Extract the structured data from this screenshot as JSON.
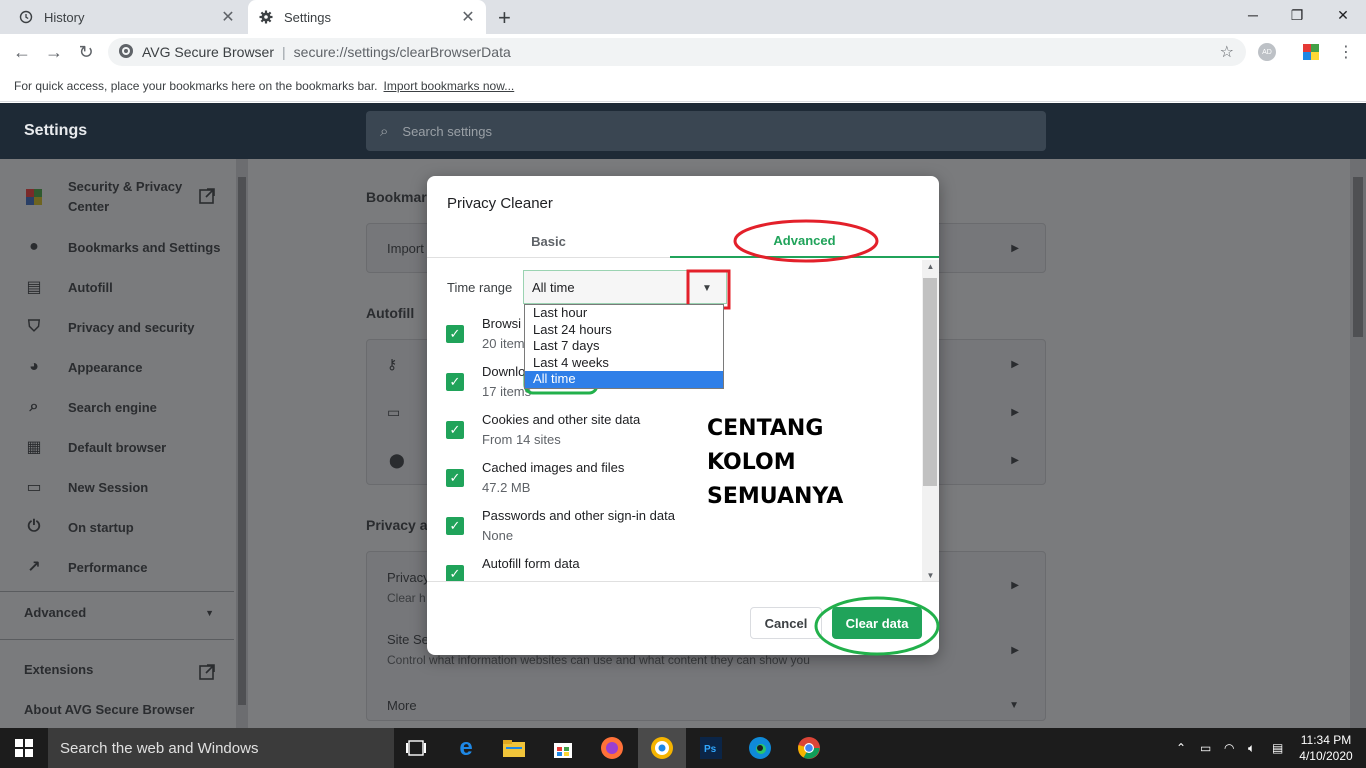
{
  "browser": {
    "tabs": [
      {
        "label": "History",
        "icon": "history-icon"
      },
      {
        "label": "Settings",
        "icon": "gear-icon"
      }
    ],
    "omnibox": {
      "site_name": "AVG Secure Browser",
      "url": "secure://settings/clearBrowserData"
    },
    "avatar_initials": "AD",
    "bookmarks_bar": {
      "text": "For quick access, place your bookmarks here on the bookmarks bar.",
      "link": "Import bookmarks now..."
    }
  },
  "settings": {
    "title": "Settings",
    "search_placeholder": "Search settings",
    "sidebar": [
      {
        "label": "Security & Privacy Center",
        "icon": "avg-logo-icon"
      },
      {
        "label": "Bookmarks and Settings",
        "icon": "person-icon"
      },
      {
        "label": "Autofill",
        "icon": "clipboard-icon"
      },
      {
        "label": "Privacy and security",
        "icon": "shield-icon"
      },
      {
        "label": "Appearance",
        "icon": "palette-icon"
      },
      {
        "label": "Search engine",
        "icon": "search-icon"
      },
      {
        "label": "Default browser",
        "icon": "browser-window-icon"
      },
      {
        "label": "New Session",
        "icon": "new-window-icon"
      },
      {
        "label": "On startup",
        "icon": "power-icon"
      },
      {
        "label": "Performance",
        "icon": "trending-icon"
      }
    ],
    "advanced_label": "Advanced",
    "extensions_label": "Extensions",
    "about_label": "About AVG Secure Browser",
    "main": {
      "section_bookmarks": "Bookmark",
      "import_row": "Import",
      "section_autofill": "Autofill",
      "section_privacy": "Privacy a",
      "privacy_row_title": "Privacy",
      "privacy_row_sub": "Clear h",
      "site_row_title": "Site Se",
      "site_row_sub": "Control what information websites can use and what content they can show you",
      "more_row": "More"
    }
  },
  "dialog": {
    "title": "Privacy Cleaner",
    "tabs": {
      "basic": "Basic",
      "advanced": "Advanced"
    },
    "time_range_label": "Time range",
    "time_range_value": "All time",
    "time_range_options": [
      "Last hour",
      "Last 24 hours",
      "Last 7 days",
      "Last 4 weeks",
      "All time"
    ],
    "items": [
      {
        "title": "Browsi",
        "sub": "20 item",
        "checked": true
      },
      {
        "title": "Downlo",
        "sub": "17 items",
        "checked": true
      },
      {
        "title": "Cookies and other site data",
        "sub": "From 14 sites",
        "checked": true
      },
      {
        "title": "Cached images and files",
        "sub": "47.2 MB",
        "checked": true
      },
      {
        "title": "Passwords and other sign-in data",
        "sub": "None",
        "checked": true
      },
      {
        "title": "Autofill form data",
        "sub": "",
        "checked": true
      }
    ],
    "annotation_lines": [
      "CENTANG",
      "KOLOM",
      "SEMUANYA"
    ],
    "cancel_label": "Cancel",
    "clear_label": "Clear data"
  },
  "taskbar": {
    "search_text": "Search the web and Windows",
    "time": "11:34 PM",
    "date": "4/10/2020"
  },
  "colors": {
    "accent_green": "#20a35a",
    "markup_red": "#e3202a",
    "markup_green": "#22b04b",
    "header_dark": "#1e2a36"
  }
}
